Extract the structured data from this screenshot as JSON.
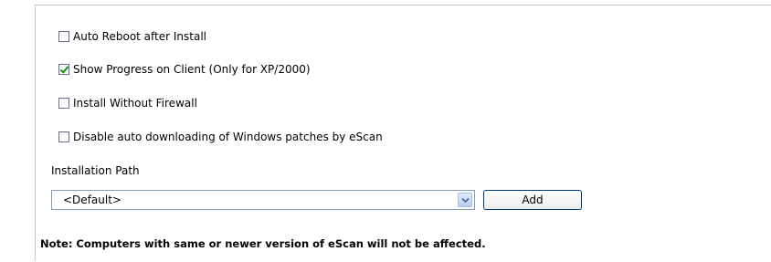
{
  "options": [
    {
      "label": "Auto Reboot after Install",
      "checked": false
    },
    {
      "label": "Show Progress on Client (Only for XP/2000)",
      "checked": true
    },
    {
      "label": "Install Without Firewall",
      "checked": false
    },
    {
      "label": "Disable auto downloading of Windows patches by eScan",
      "checked": false
    }
  ],
  "installation_path": {
    "label": "Installation Path",
    "selected": "<Default>",
    "add_label": "Add"
  },
  "note": "Note: Computers with same or newer version of eScan will not be affected.",
  "colors": {
    "check": "#1d8a1d",
    "select_border": "#7f9db9",
    "button_border": "#003c74"
  }
}
